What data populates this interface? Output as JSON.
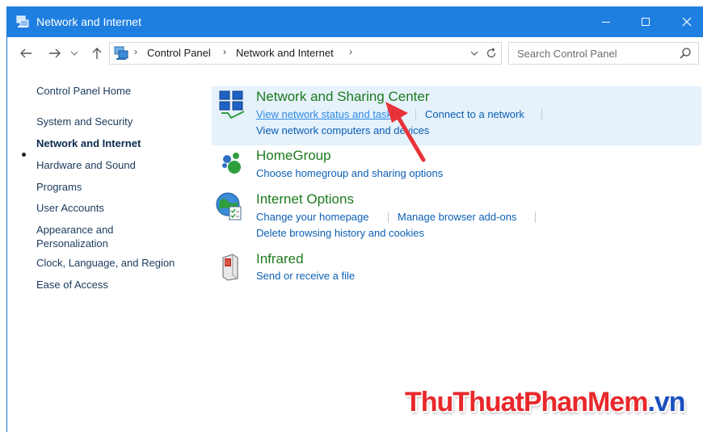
{
  "window": {
    "title": "Network and Internet",
    "controls": {
      "minimize": "minimize-icon",
      "maximize": "maximize-icon",
      "close": "close-icon"
    }
  },
  "nav": {
    "back_icon": "back-arrow-icon",
    "forward_icon": "forward-arrow-icon",
    "recent_icon": "chevron-down-icon",
    "up_icon": "up-arrow-icon",
    "breadcrumbs": [
      "Control Panel",
      "Network and Internet"
    ],
    "refresh_icon": "refresh-icon",
    "search_placeholder": "Search Control Panel"
  },
  "sidebar": {
    "items": [
      {
        "label": "Control Panel Home"
      },
      {
        "label": "System and Security"
      },
      {
        "label": "Network and Internet",
        "active": true
      },
      {
        "label": "Hardware and Sound"
      },
      {
        "label": "Programs"
      },
      {
        "label": "User Accounts"
      },
      {
        "label": "Appearance and Personalization",
        "lines": [
          "Appearance and",
          "Personalization"
        ]
      },
      {
        "label": "Clock, Language, and Region"
      },
      {
        "label": "Ease of Access"
      }
    ]
  },
  "categories": [
    {
      "title": "Network and Sharing Center",
      "icon": "network-sharing-icon",
      "links": [
        "View network status and tasks",
        "Connect to a network",
        "View network computers and devices"
      ],
      "highlighted": true
    },
    {
      "title": "HomeGroup",
      "icon": "homegroup-icon",
      "links": [
        "Choose homegroup and sharing options"
      ]
    },
    {
      "title": "Internet Options",
      "icon": "internet-options-icon",
      "links": [
        "Change your homepage",
        "Manage browser add-ons",
        "Delete browsing history and cookies"
      ]
    },
    {
      "title": "Infrared",
      "icon": "infrared-icon",
      "links": [
        "Send or receive a file"
      ]
    }
  ],
  "watermark": {
    "part1": "ThuThuat",
    "part2": "PhanMem",
    "part3": ".vn"
  },
  "colors": {
    "titlebar": "#1f7fe0",
    "highlight": "#e5f1fb",
    "category_title": "#1d7a1d",
    "link": "#0b5fb5",
    "arrow": "#e8323a"
  }
}
